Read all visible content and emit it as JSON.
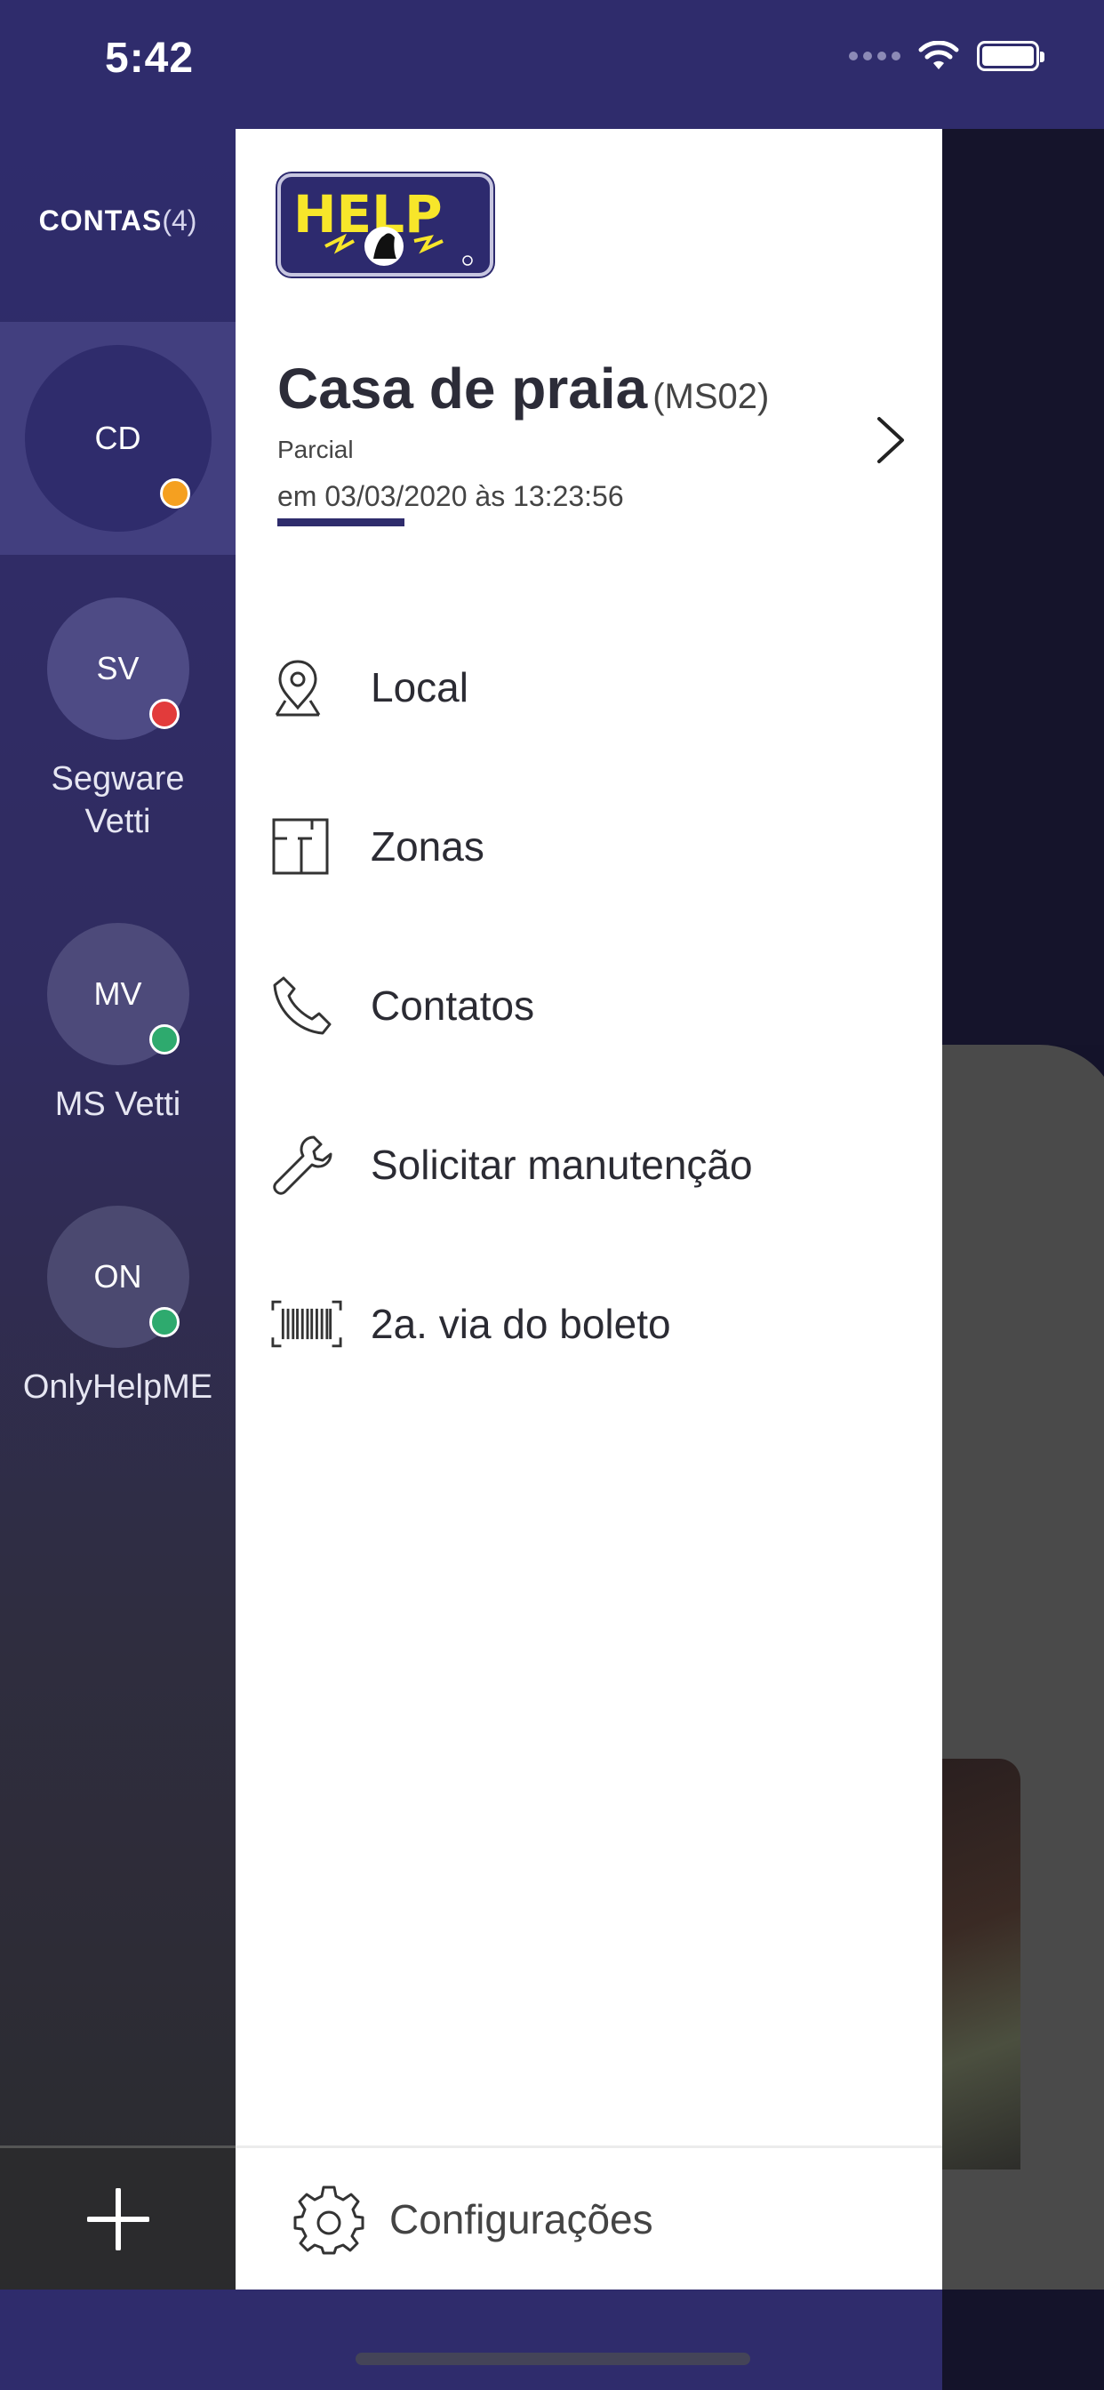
{
  "status_bar": {
    "time": "5:42"
  },
  "accounts": {
    "title": "CONTAS",
    "count": "(4)",
    "items": [
      {
        "initials": "CD",
        "name": "",
        "status_color": "#f5a020",
        "active": true
      },
      {
        "initials": "SV",
        "name": "Segware Vetti",
        "name_line1": "Segware",
        "name_line2": "Vetti",
        "status_color": "#e23b3b",
        "active": false
      },
      {
        "initials": "MV",
        "name": "MS Vetti",
        "status_color": "#2eaa6e",
        "active": false
      },
      {
        "initials": "ON",
        "name": "OnlyHelpME",
        "status_color": "#2eaa6e",
        "active": false
      }
    ],
    "add_icon": "plus-icon"
  },
  "drawer": {
    "logo_text": "HELP",
    "place": {
      "name": "Casa de praia",
      "code": "(MS02)",
      "status": "Parcial",
      "date": "em 03/03/2020 às 13:23:56"
    },
    "menu": [
      {
        "label": "Local",
        "icon": "location-pin-icon"
      },
      {
        "label": "Zonas",
        "icon": "floor-plan-icon"
      },
      {
        "label": "Contatos",
        "icon": "phone-icon"
      },
      {
        "label": "Solicitar manutenção",
        "icon": "wrench-icon"
      },
      {
        "label": "2a. via do boleto",
        "icon": "barcode-icon"
      }
    ],
    "settings_label": "Configurações"
  },
  "colors": {
    "primary": "#2f2c6c",
    "drawer_bg": "#ffffff",
    "warning": "#f5a020",
    "danger": "#e23b3b",
    "ok": "#2eaa6e"
  }
}
